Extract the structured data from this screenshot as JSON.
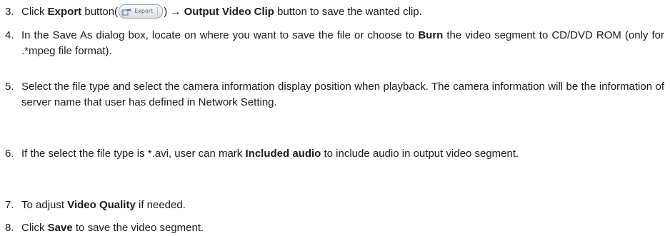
{
  "steps": [
    {
      "num": "3.",
      "parts": {
        "a": "Click ",
        "b": "Export",
        "c": " button(",
        "d": ") → ",
        "e": "Output Video Clip",
        "f": " button to save the wanted clip."
      },
      "export_button": {
        "label": "Export",
        "icon": "export-film-icon"
      }
    },
    {
      "num": "4.",
      "parts": {
        "a": "In the Save As dialog box, locate on where you want to save the file or choose to ",
        "b": "Burn",
        "c": " the video segment to CD/DVD ROM (only for .*mpeg file format)."
      }
    },
    {
      "num": "5.",
      "parts": {
        "a": "Select the file type and select the camera information display position when playback. The camera information will be the information of server name that user has defined in Network Setting."
      }
    },
    {
      "num": "6.",
      "parts": {
        "a": "If the select the file type is *.avi, user can mark ",
        "b": "Included audio",
        "c": " to include audio in output video segment."
      }
    },
    {
      "num": "7.",
      "parts": {
        "a": "To adjust ",
        "b": "Video Quality",
        "c": " if needed."
      }
    },
    {
      "num": "8.",
      "parts": {
        "a": "Click ",
        "b": "Save",
        "c": " to save the video segment."
      }
    }
  ]
}
